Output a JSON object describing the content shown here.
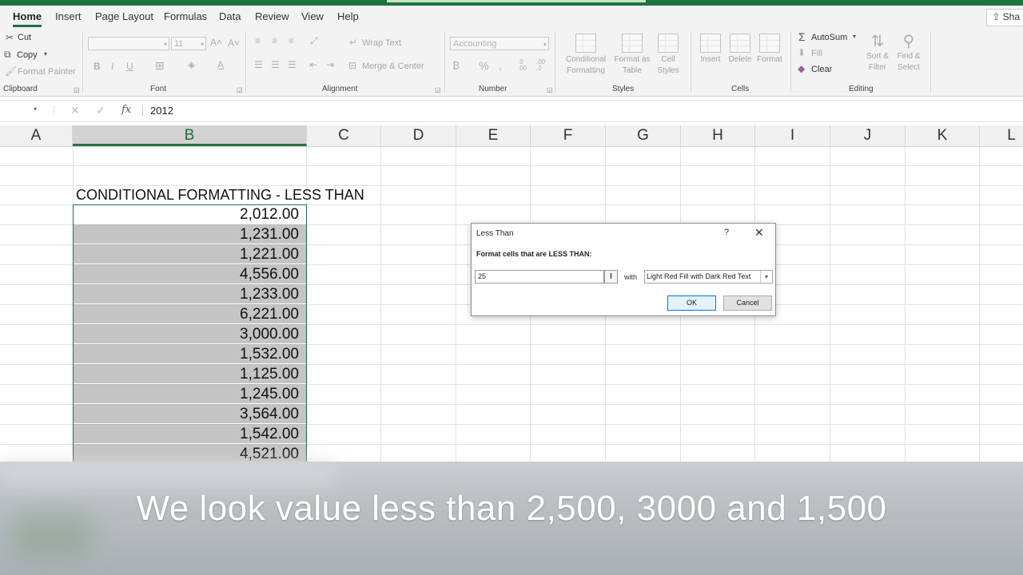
{
  "ribbon": {
    "tabs": [
      "Home",
      "Insert",
      "Page Layout",
      "Formulas",
      "Data",
      "Review",
      "View",
      "Help"
    ],
    "active_tab": "Home",
    "share_label": "Sha",
    "clipboard": {
      "cut": "Cut",
      "copy": "Copy",
      "format_painter": "Format Painter",
      "group": "Clipboard"
    },
    "font": {
      "name": "",
      "size": "11",
      "group": "Font"
    },
    "alignment": {
      "wrap_text": "Wrap Text",
      "merge_center": "Merge & Center",
      "group": "Alignment"
    },
    "number": {
      "format": "Accounting",
      "group": "Number"
    },
    "styles": {
      "conditional_formatting": [
        "Conditional",
        "Formatting"
      ],
      "format_as_table": [
        "Format as",
        "Table"
      ],
      "cell_styles": [
        "Cell",
        "Styles"
      ],
      "group": "Styles"
    },
    "cells": {
      "insert": "Insert",
      "delete": "Delete",
      "format": "Format",
      "group": "Cells"
    },
    "editing": {
      "autosum": "AutoSum",
      "fill": "Fill",
      "clear": "Clear",
      "sort_filter": [
        "Sort &",
        "Filter"
      ],
      "find_select": [
        "Find &",
        "Select"
      ],
      "group": "Editing"
    }
  },
  "formula_bar": {
    "fx": "fx",
    "value": "2012"
  },
  "columns": [
    "A",
    "B",
    "C",
    "D",
    "E",
    "F",
    "G",
    "H",
    "I",
    "J",
    "K",
    "L"
  ],
  "sheet": {
    "title": "CONDITIONAL FORMATTING  - LESS THAN",
    "values": [
      "2,012.00",
      "1,231.00",
      "1,221.00",
      "4,556.00",
      "1,233.00",
      "6,221.00",
      "3,000.00",
      "1,532.00",
      "1,125.00",
      "1,245.00",
      "3,564.00",
      "1,542.00",
      "4,521.00"
    ]
  },
  "dialog": {
    "title": "Less Than",
    "help": "?",
    "close": "✕",
    "prompt": "Format cells that are LESS THAN:",
    "input_value": "25",
    "with_label": "with",
    "format_option": "Light Red Fill with Dark Red Text",
    "ok_label": "OK",
    "cancel_label": "Cancel"
  },
  "caption": "We look value less than 2,500, 3000 and 1,500",
  "colors": {
    "excel_green": "#217346",
    "selection_gray": "#c4c4c4"
  }
}
